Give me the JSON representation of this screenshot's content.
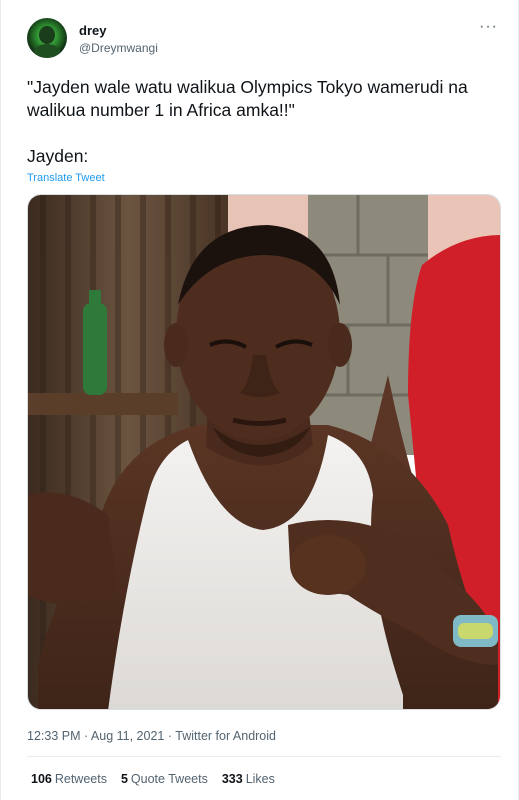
{
  "user": {
    "name": "drey",
    "handle": "@Dreymwangi"
  },
  "tweet": {
    "text": "\"Jayden wale watu walikua Olympics Tokyo wamerudi na walikua number 1 in Africa amka!!\"\n\nJayden:",
    "translate_label": "Translate Tweet",
    "timestamp": "12:33 PM · Aug 11, 2021 · Twitter for Android"
  },
  "menu": {
    "more_icon": "more-horizontal-icon",
    "more_glyph": "···"
  },
  "stats": {
    "retweets_count": "106",
    "retweets_label": "Retweets",
    "quotes_count": "5",
    "quotes_label": "Quote Tweets",
    "likes_count": "333",
    "likes_label": "Likes"
  },
  "colors": {
    "link": "#1d9bf0",
    "secondary_text": "#536471",
    "primary_text": "#0f1419"
  }
}
